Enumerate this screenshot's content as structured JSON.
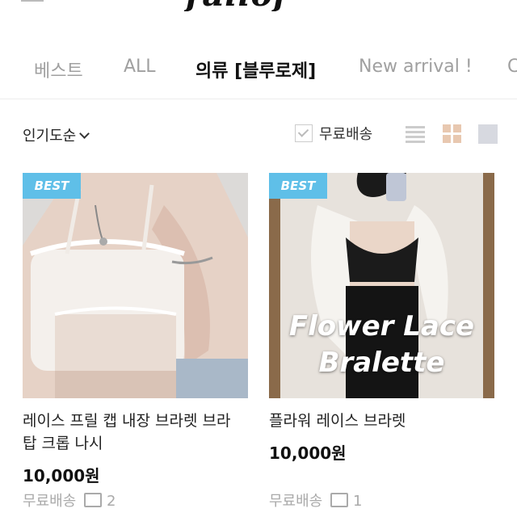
{
  "header": {
    "logo_text": "fullof"
  },
  "nav": {
    "tabs": [
      "베스트",
      "ALL",
      "의류 [블루로제]",
      "New arrival !",
      "C"
    ],
    "active": "의류 [블루로제]"
  },
  "toolbar": {
    "sort_label": "인기도순",
    "free_shipping_label": "무료배송"
  },
  "products": [
    {
      "badge": "BEST",
      "name_line1": "레이스 프릴 캡 내장 브라렛 브라",
      "name_line2": "탑 크롭 나시",
      "price": "10,000원",
      "shipping": "무료배송",
      "comments": "2",
      "overlay_line1": "",
      "overlay_line2": ""
    },
    {
      "badge": "BEST",
      "name_line1": "플라워 레이스 브라렛",
      "name_line2": "",
      "price": "10,000원",
      "shipping": "무료배송",
      "comments": "1",
      "overlay_line1": "Flower Lace",
      "overlay_line2": "Bralette"
    }
  ],
  "colors": {
    "badge": "#5fbfe8",
    "active_tab": "#111111",
    "inactive_tab": "#a0a0a0"
  },
  "icons": [
    "checkbox-icon",
    "list-view-icon",
    "grid-view-icon",
    "large-view-icon",
    "comment-icon",
    "chevron-down-icon"
  ]
}
